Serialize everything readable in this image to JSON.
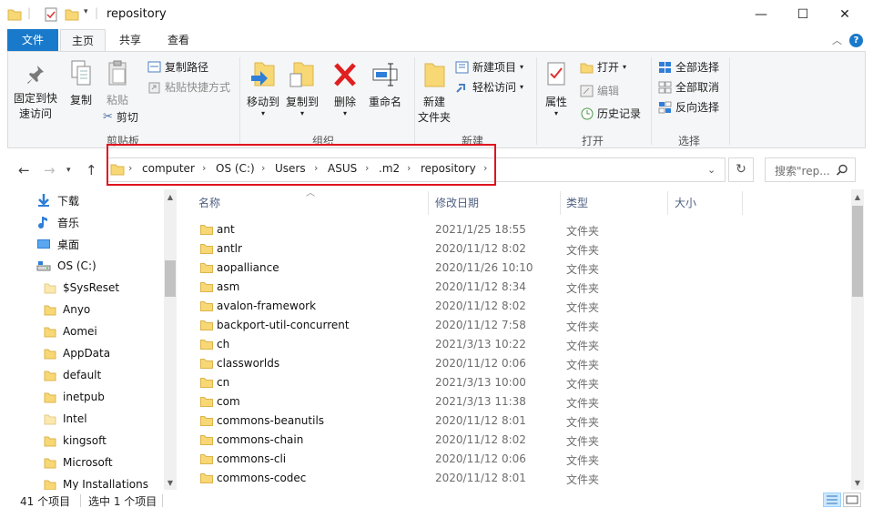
{
  "window": {
    "title": "repository",
    "minimize_glyph": "—",
    "maximize_glyph": "☐",
    "close_glyph": "✕"
  },
  "ribbon_tabs": [
    {
      "label": "文件",
      "icon": ""
    },
    {
      "label": "主页"
    },
    {
      "label": "共享"
    },
    {
      "label": "查看"
    }
  ],
  "ribbon": {
    "clipboard": {
      "pin_label": "固定到快\n速访问",
      "copy_label": "复制",
      "paste_label": "粘贴",
      "copy_path_label": "复制路径",
      "paste_shortcut_label": "粘贴快捷方式",
      "cut_label": "剪切",
      "group_label": "剪贴板"
    },
    "organize": {
      "move_to_label": "移动到",
      "copy_to_label": "复制到",
      "delete_label": "删除",
      "rename_label": "重命名",
      "group_label": "组织"
    },
    "new": {
      "new_folder_label": "新建\n文件夹",
      "new_item_label": "新建项目",
      "easy_access_label": "轻松访问",
      "group_label": "新建"
    },
    "open": {
      "properties_label": "属性",
      "open_label": "打开",
      "edit_label": "编辑",
      "history_label": "历史记录",
      "group_label": "打开"
    },
    "select": {
      "select_all_label": "全部选择",
      "select_none_label": "全部取消",
      "invert_label": "反向选择",
      "group_label": "选择"
    }
  },
  "address": {
    "crumbs": [
      "computer",
      "OS (C:)",
      "Users",
      "ASUS",
      ".m2",
      "repository"
    ],
    "separator": "›",
    "search_placeholder": "搜索\"rep...",
    "highlight_color": "#e0141e"
  },
  "nav_pane": {
    "items": [
      {
        "label": "下载",
        "icon": "download-icon"
      },
      {
        "label": "音乐",
        "icon": "music-icon"
      },
      {
        "label": "桌面",
        "icon": "desktop-icon"
      },
      {
        "label": "OS (C:)",
        "icon": "drive-icon"
      },
      {
        "label": "$SysReset",
        "icon": "folder-icon"
      },
      {
        "label": "Anyo",
        "icon": "folder-icon"
      },
      {
        "label": "Aomei",
        "icon": "folder-icon"
      },
      {
        "label": "AppData",
        "icon": "folder-icon"
      },
      {
        "label": "default",
        "icon": "folder-icon"
      },
      {
        "label": "inetpub",
        "icon": "folder-icon"
      },
      {
        "label": "Intel",
        "icon": "folder-icon"
      },
      {
        "label": "kingsoft",
        "icon": "folder-icon"
      },
      {
        "label": "Microsoft",
        "icon": "folder-icon"
      },
      {
        "label": "My Installations",
        "icon": "folder-icon"
      }
    ]
  },
  "file_list": {
    "columns": [
      "名称",
      "修改日期",
      "类型",
      "大小"
    ],
    "rows": [
      {
        "name": "ant",
        "date": "2021/1/25 18:55",
        "type": "文件夹"
      },
      {
        "name": "antlr",
        "date": "2020/11/12 8:02",
        "type": "文件夹"
      },
      {
        "name": "aopalliance",
        "date": "2020/11/26 10:10",
        "type": "文件夹"
      },
      {
        "name": "asm",
        "date": "2020/11/12 8:34",
        "type": "文件夹"
      },
      {
        "name": "avalon-framework",
        "date": "2020/11/12 8:02",
        "type": "文件夹"
      },
      {
        "name": "backport-util-concurrent",
        "date": "2020/11/12 7:58",
        "type": "文件夹"
      },
      {
        "name": "ch",
        "date": "2021/3/13 10:22",
        "type": "文件夹"
      },
      {
        "name": "classworlds",
        "date": "2020/11/12 0:06",
        "type": "文件夹"
      },
      {
        "name": "cn",
        "date": "2021/3/13 10:00",
        "type": "文件夹"
      },
      {
        "name": "com",
        "date": "2021/3/13 11:38",
        "type": "文件夹"
      },
      {
        "name": "commons-beanutils",
        "date": "2020/11/12 8:01",
        "type": "文件夹"
      },
      {
        "name": "commons-chain",
        "date": "2020/11/12 8:02",
        "type": "文件夹"
      },
      {
        "name": "commons-cli",
        "date": "2020/11/12 0:06",
        "type": "文件夹"
      },
      {
        "name": "commons-codec",
        "date": "2020/11/12 8:01",
        "type": "文件夹"
      }
    ]
  },
  "status_bar": {
    "item_count": "41 个项目",
    "selected": "选中 1 个项目"
  }
}
